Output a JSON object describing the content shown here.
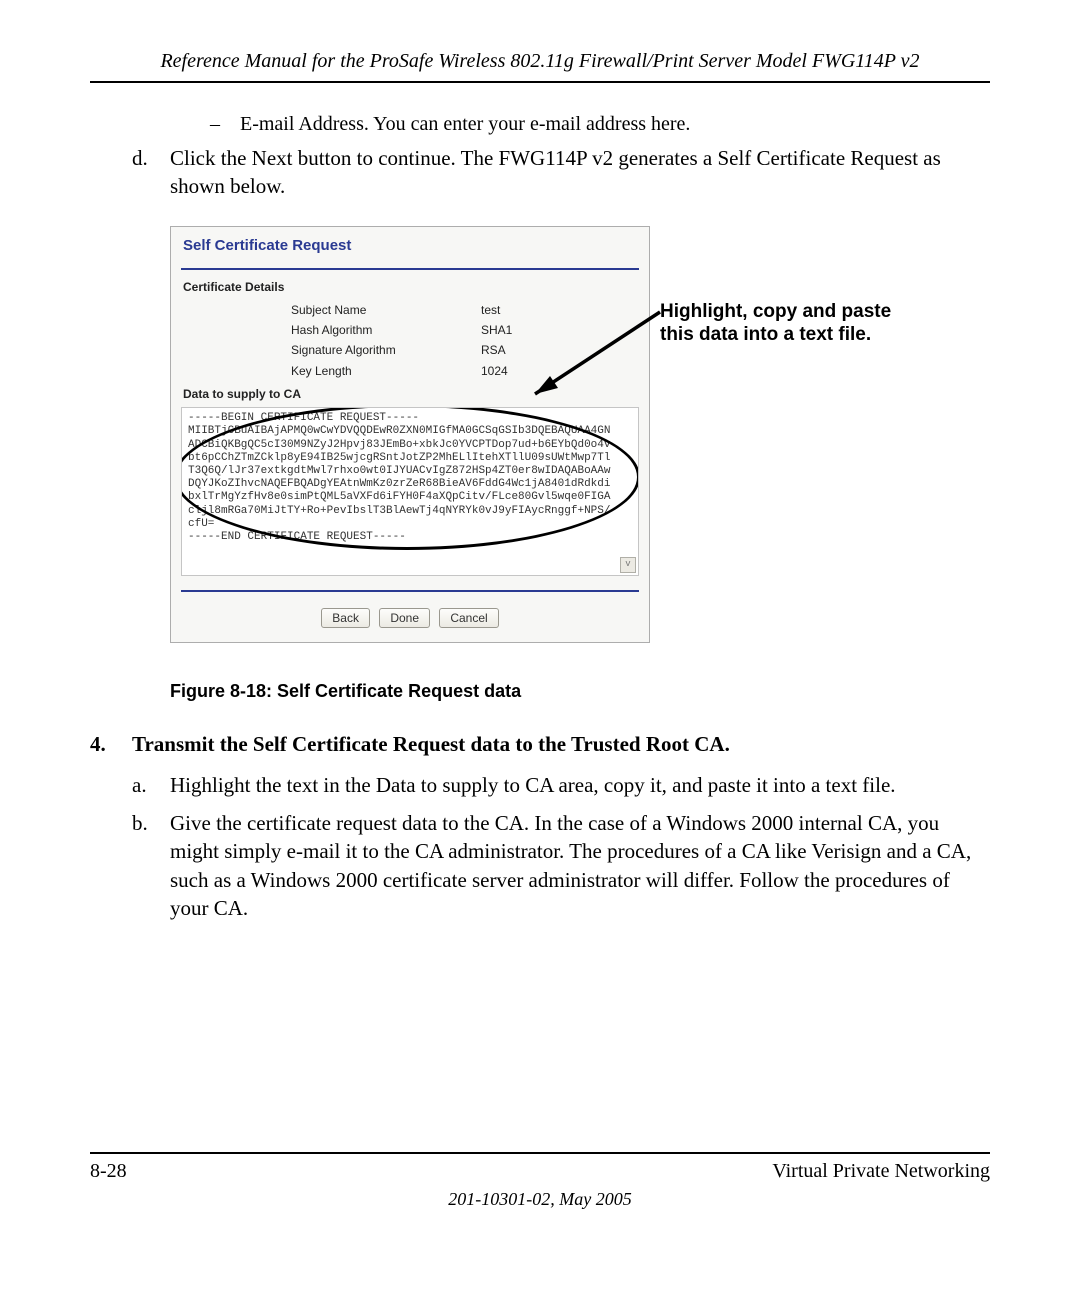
{
  "header": {
    "running_head": "Reference Manual for the ProSafe Wireless 802.11g  Firewall/Print Server Model FWG114P v2"
  },
  "body": {
    "email_bullet": "E-mail Address. You can enter your e-mail address here.",
    "item_d_letter": "d.",
    "item_d_text": "Click the Next button to continue. The FWG114P v2 generates a Self Certificate Request as shown below."
  },
  "panel": {
    "title": "Self Certificate Request",
    "section_details": "Certificate Details",
    "rows": {
      "subject_k": "Subject Name",
      "subject_v": "test",
      "hash_k": "Hash Algorithm",
      "hash_v": "SHA1",
      "sig_k": "Signature Algorithm",
      "sig_v": "RSA",
      "key_k": "Key Length",
      "key_v": "1024"
    },
    "section_supply": "Data to supply to CA",
    "csr": "-----BEGIN CERTIFICATE REQUEST-----\nMIIBTjCBuAIBAjAPMQ0wCwYDVQQDEwR0ZXN0MIGfMA0GCSqGSIb3DQEBAQUAA4GN\nADCBiQKBgQC5cI30M9NZyJ2Hpvj83JEmBo+xbkJc0YVCPTDop7ud+b6EYbQd0o4v\nbt6pCChZTmZCklp8yE94IB25wjcgRSntJotZP2MhELlItehXTllU09sUWtMwp7Tl\nT3Q6Q/lJr37extkgdtMwl7rhxo0wt0IJYUACvIgZ872HSp4ZT0er8wIDAQABoAAw\nDQYJKoZIhvcNAQEFBQADgYEAtnWmKz0zrZeR68BieAV6FddG4Wc1jA8401dRdkdi\nbxlTrMgYzfHv8e0simPtQML5aVXFd6iFYH0F4aXQpCitv/FLce80Gvl5wqe0FIGA\ncljl8mRGa70MiJtTY+Ro+PevIbslT3BlAewTj4qNYRYk0vJ9yFIAycRnggf+NPS/\ncfU=\n-----END CERTIFICATE REQUEST-----",
    "buttons": {
      "back": "Back",
      "done": "Done",
      "cancel": "Cancel"
    }
  },
  "callout": "Highlight, copy and paste this data into a text file.",
  "figure_caption": "Figure 8-18:  Self Certificate Request data",
  "step4": {
    "num": "4.",
    "title": "Transmit the Self Certificate Request data to the Trusted Root CA.",
    "a_letter": "a.",
    "a_text": "Highlight the text in the Data to supply to CA area, copy it, and paste it into a text file.",
    "b_letter": "b.",
    "b_text": "Give the certificate request data to the CA. In the case of a Windows 2000 internal CA, you might simply e-mail it to the CA administrator. The procedures of a CA like Verisign and a CA, such as a Windows 2000 certificate server administrator will differ. Follow the procedures of your CA."
  },
  "footer": {
    "page_no": "8-28",
    "section": "Virtual Private Networking",
    "doc_id": "201-10301-02, May 2005"
  }
}
